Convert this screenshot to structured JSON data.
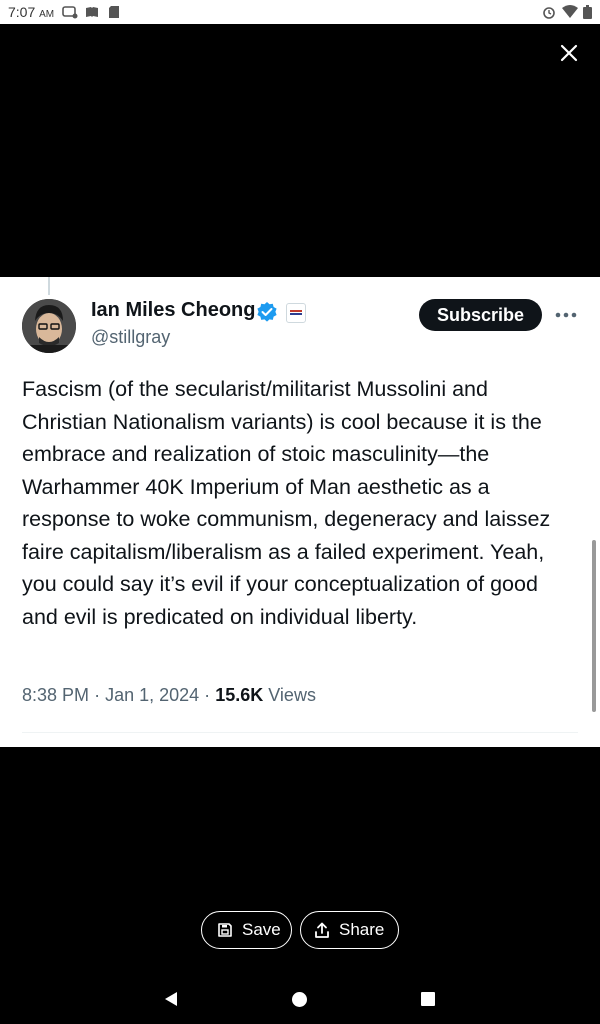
{
  "status_bar": {
    "time": "7:07",
    "ampm": "AM"
  },
  "tweet": {
    "display_name": "Ian Miles Cheong",
    "handle": "@stillgray",
    "subscribe_label": "Subscribe",
    "text": "Fascism (of the secularist/militarist Mussolini and Christian Nationalism variants) is cool because it is the embrace and realization of stoic masculinity—the Warhammer 40K Imperium of Man aesthetic as a response to woke communism, degeneracy and laissez faire capitalism/liberalism as a failed experiment. Yeah, you could say it’s evil if your conceptualization of good and evil is predicated on individual liberty.",
    "time": "8:38 PM",
    "date": "Jan 1, 2024",
    "views_count": "15.6K",
    "views_label": "Views",
    "separator": "·"
  },
  "actions": {
    "save_label": "Save",
    "share_label": "Share"
  },
  "colors": {
    "verified": "#1d9bf0",
    "text": "#0f1419",
    "secondary": "#536471"
  }
}
